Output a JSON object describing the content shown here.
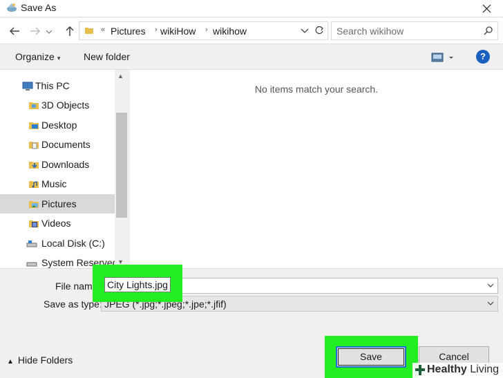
{
  "window": {
    "title": "Save As"
  },
  "address": {
    "crumbs": [
      "Pictures",
      "wikiHow",
      "wikihow"
    ]
  },
  "search": {
    "placeholder": "Search wikihow"
  },
  "toolbar": {
    "organize": "Organize",
    "new_folder": "New folder",
    "help": "?"
  },
  "nav": {
    "items": [
      {
        "label": "This PC",
        "icon": "computer-icon"
      },
      {
        "label": "3D Objects",
        "icon": "3d-objects-folder-icon"
      },
      {
        "label": "Desktop",
        "icon": "desktop-folder-icon"
      },
      {
        "label": "Documents",
        "icon": "documents-folder-icon"
      },
      {
        "label": "Downloads",
        "icon": "downloads-folder-icon"
      },
      {
        "label": "Music",
        "icon": "music-folder-icon"
      },
      {
        "label": "Pictures",
        "icon": "pictures-folder-icon",
        "selected": true
      },
      {
        "label": "Videos",
        "icon": "videos-folder-icon"
      },
      {
        "label": "Local Disk (C:)",
        "icon": "disk-icon"
      },
      {
        "label": "System Reserved",
        "icon": "disk-icon"
      }
    ]
  },
  "content": {
    "empty_message": "No items match your search."
  },
  "form": {
    "file_name_label": "File nam",
    "file_name_value": "City Lights.jpg",
    "save_type_label": "Save as type:",
    "save_type_value": "JPEG (*.jpg;*.jpeg;*.jpe;*.jfif)"
  },
  "footer": {
    "hide_folders": "Hide Folders",
    "save": "Save",
    "cancel": "Cancel"
  },
  "watermark": {
    "bold": "Healthy",
    "thin": "Living"
  },
  "colors": {
    "highlight": "#22ee22",
    "accent": "#1e6fd0",
    "help": "#1b5fbf"
  }
}
